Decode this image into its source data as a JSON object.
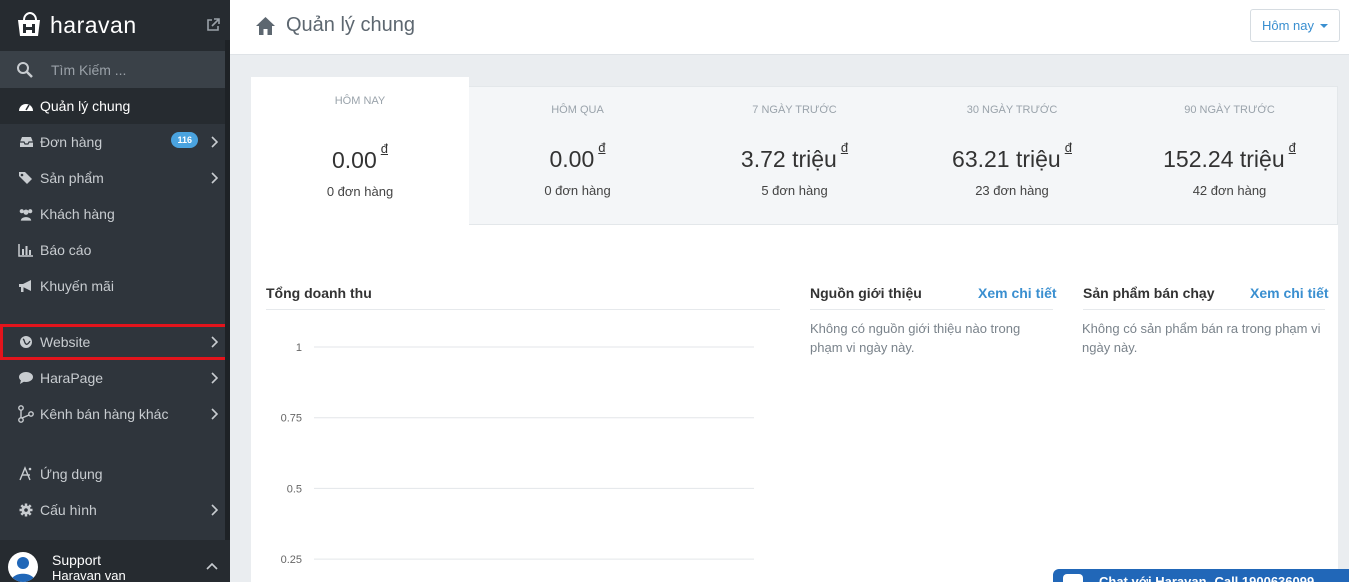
{
  "brand": {
    "name": "haravan"
  },
  "search": {
    "placeholder": "Tìm Kiếm ..."
  },
  "sidebar": {
    "items": [
      {
        "label": "Quản lý chung",
        "icon": "dashboard-icon",
        "active": true
      },
      {
        "label": "Đơn hàng",
        "icon": "inbox-icon",
        "badge": "116"
      },
      {
        "label": "Sản phẩm",
        "icon": "tags-icon"
      },
      {
        "label": "Khách hàng",
        "icon": "users-icon"
      },
      {
        "label": "Báo cáo",
        "icon": "bar-chart-icon"
      },
      {
        "label": "Khuyến mãi",
        "icon": "megaphone-icon"
      },
      {
        "label": "Website",
        "icon": "globe-icon"
      },
      {
        "label": "HaraPage",
        "icon": "comment-icon"
      },
      {
        "label": "Kênh bán hàng khác",
        "icon": "share-icon"
      },
      {
        "label": "Ứng dụng",
        "icon": "apps-icon"
      },
      {
        "label": "Cấu hình",
        "icon": "gear-icon"
      }
    ],
    "support": {
      "title": "Support",
      "subtitle": "Haravan van"
    }
  },
  "header": {
    "title": "Quản lý chung",
    "range_label": "Hôm nay"
  },
  "stats": [
    {
      "label": "HÔM NAY",
      "value": "0.00",
      "currency": "đ",
      "orders": "0 đơn hàng"
    },
    {
      "label": "HÔM QUA",
      "value": "0.00",
      "currency": "đ",
      "orders": "0 đơn hàng"
    },
    {
      "label": "7 NGÀY TRƯỚC",
      "value": "3.72 triệu",
      "currency": "đ",
      "orders": "5 đơn hàng"
    },
    {
      "label": "30 NGÀY TRƯỚC",
      "value": "63.21 triệu",
      "currency": "đ",
      "orders": "23 đơn hàng"
    },
    {
      "label": "90 NGÀY TRƯỚC",
      "value": "152.24 triệu",
      "currency": "đ",
      "orders": "42 đơn hàng"
    }
  ],
  "revenue": {
    "title": "Tổng doanh thu"
  },
  "referrals": {
    "title": "Nguồn giới thiệu",
    "link": "Xem chi tiết",
    "line1": "Không có nguồn giới thiệu nào trong",
    "line2": "phạm vi ngày này."
  },
  "bestsellers": {
    "title": "Sản phẩm bán chạy",
    "link": "Xem chi tiết",
    "line1": "Không có sản phẩm bán ra trong phạm vi",
    "line2": "ngày này."
  },
  "chat": {
    "label": "Chat với Haravan- Call 1900636099"
  },
  "chart_data": {
    "type": "line",
    "title": "Tổng doanh thu",
    "y_ticks": [
      "1",
      "0.75",
      "0.5",
      "0.25"
    ],
    "ylim": [
      0,
      1
    ],
    "series": [],
    "grid": true
  }
}
